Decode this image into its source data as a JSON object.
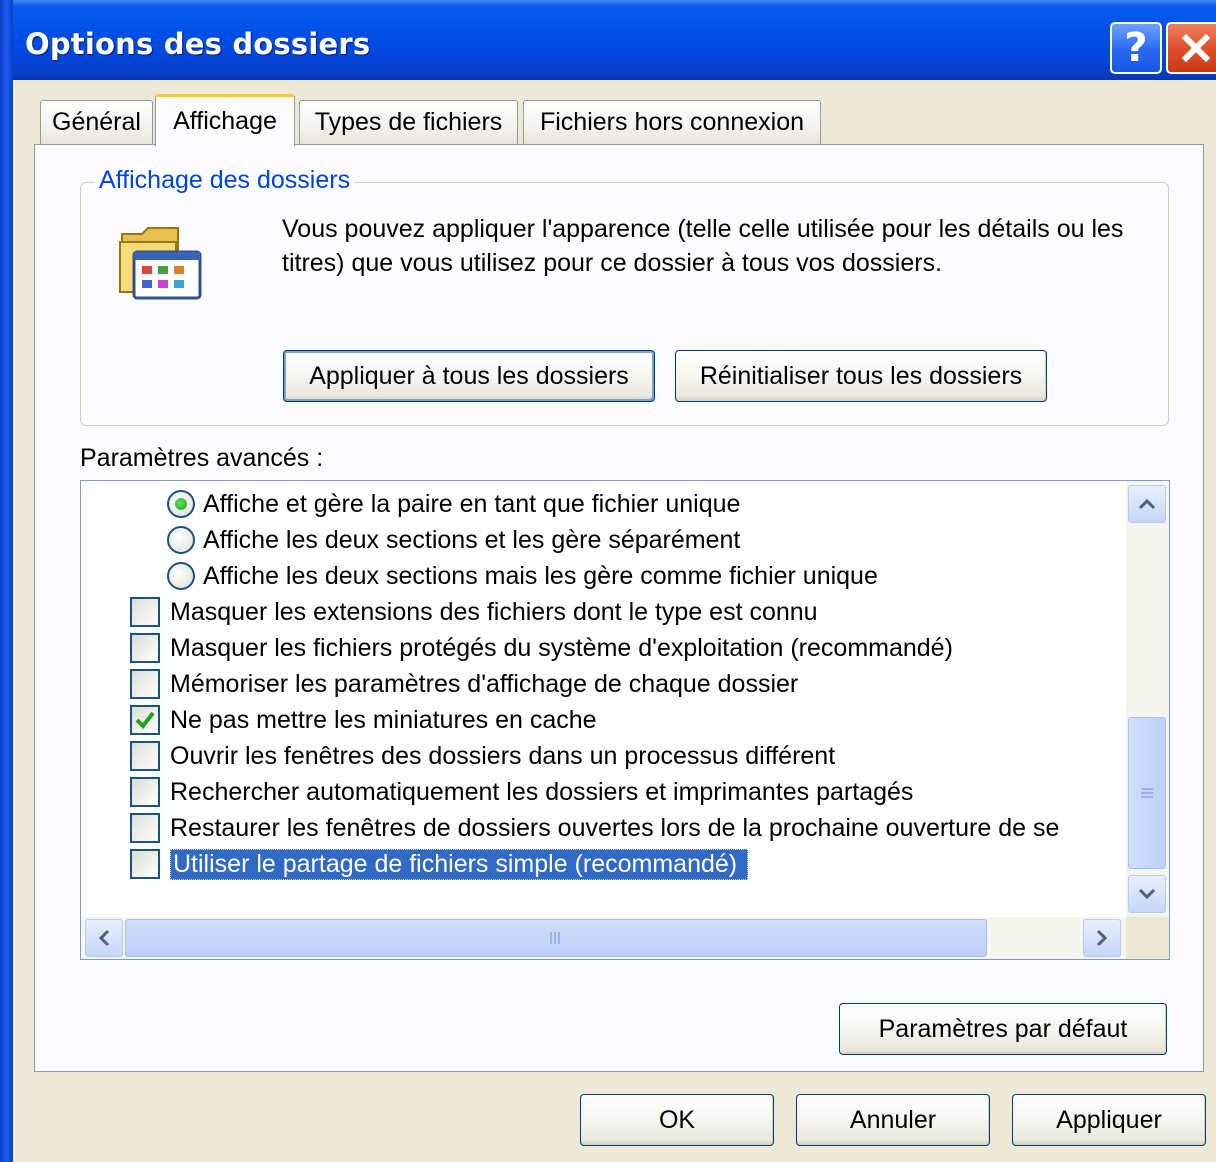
{
  "window": {
    "title": "Options des dossiers",
    "help_button": "?",
    "close_button": "close"
  },
  "tabs": [
    {
      "label": "Général",
      "active": false
    },
    {
      "label": "Affichage",
      "active": true
    },
    {
      "label": "Types de fichiers",
      "active": false
    },
    {
      "label": "Fichiers hors connexion",
      "active": false
    }
  ],
  "folder_views": {
    "title": "Affichage des dossiers",
    "description": "Vous pouvez appliquer l'apparence (telle celle utilisée pour les détails ou les titres) que vous utilisez pour ce dossier à tous vos dossiers.",
    "apply_all_label": "Appliquer à tous les dossiers",
    "reset_all_label": "Réinitialiser tous les dossiers"
  },
  "advanced": {
    "label": "Paramètres avancés :",
    "items": [
      {
        "type": "radio",
        "label": "Affiche et gère la paire en tant que fichier unique",
        "checked": true
      },
      {
        "type": "radio",
        "label": "Affiche les deux sections et les gère séparément",
        "checked": false
      },
      {
        "type": "radio",
        "label": "Affiche les deux sections mais les gère comme fichier unique",
        "checked": false
      },
      {
        "type": "checkbox",
        "label": "Masquer les extensions des fichiers dont le type est connu",
        "checked": false
      },
      {
        "type": "checkbox",
        "label": "Masquer les fichiers protégés du système d'exploitation (recommandé)",
        "checked": false
      },
      {
        "type": "checkbox",
        "label": "Mémoriser les paramètres d'affichage de chaque dossier",
        "checked": false
      },
      {
        "type": "checkbox",
        "label": "Ne pas mettre les miniatures en cache",
        "checked": true
      },
      {
        "type": "checkbox",
        "label": "Ouvrir les fenêtres des dossiers dans un processus différent",
        "checked": false
      },
      {
        "type": "checkbox",
        "label": "Rechercher automatiquement les dossiers et imprimantes partagés",
        "checked": false
      },
      {
        "type": "checkbox",
        "label": "Restaurer les fenêtres de dossiers ouvertes lors de la prochaine ouverture de se",
        "checked": false
      },
      {
        "type": "checkbox",
        "label": "Utiliser le partage de fichiers simple (recommandé)",
        "checked": false,
        "selected": true
      }
    ],
    "defaults_label": "Paramètres par défaut"
  },
  "footer": {
    "ok_label": "OK",
    "cancel_label": "Annuler",
    "apply_label": "Appliquer"
  },
  "colors": {
    "title_bar": "#0052e8",
    "group_title": "#0046d5",
    "selection": "#316ac5",
    "dialog_bg": "#ece9d8",
    "radio_dot": "#21a121",
    "check_mark": "#21a121"
  },
  "icons": {
    "folder": "folder-icon",
    "scroll_up": "chevron-up-icon",
    "scroll_down": "chevron-down-icon",
    "scroll_left": "chevron-left-icon",
    "scroll_right": "chevron-right-icon"
  }
}
